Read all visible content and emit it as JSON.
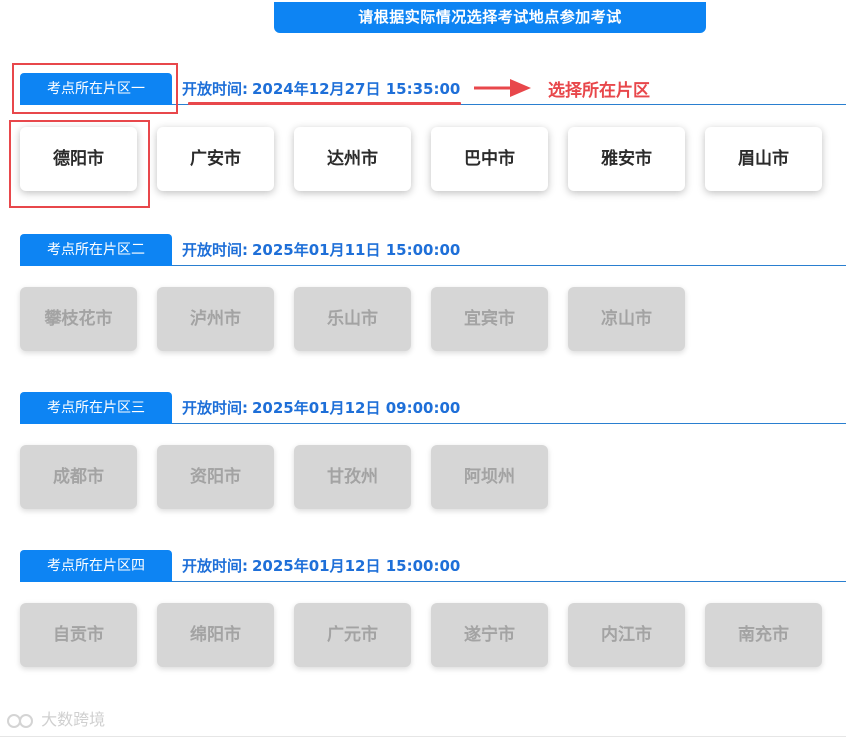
{
  "notice": "请根据实际情况选择考试地点参加考试",
  "regions": [
    {
      "tag": "考点所在片区一",
      "open_label": "开放时间:",
      "open_time": "2024年12月27日 15:35:00",
      "cities": [
        "德阳市",
        "广安市",
        "达州市",
        "巴中市",
        "雅安市",
        "眉山市"
      ]
    },
    {
      "tag": "考点所在片区二",
      "open_label": "开放时间:",
      "open_time": "2025年01月11日 15:00:00",
      "cities": [
        "攀枝花市",
        "泸州市",
        "乐山市",
        "宜宾市",
        "凉山市"
      ]
    },
    {
      "tag": "考点所在片区三",
      "open_label": "开放时间:",
      "open_time": "2025年01月12日 09:00:00",
      "cities": [
        "成都市",
        "资阳市",
        "甘孜州",
        "阿坝州"
      ]
    },
    {
      "tag": "考点所在片区四",
      "open_label": "开放时间:",
      "open_time": "2025年01月12日 15:00:00",
      "cities": [
        "自贡市",
        "绵阳市",
        "广元市",
        "遂宁市",
        "内江市",
        "南充市"
      ]
    }
  ],
  "annotation": {
    "text": "选择所在片区",
    "color": "#e8474b"
  },
  "watermark": "大数跨境",
  "colors": {
    "accent": "#0d84f3",
    "time_text": "#1e6fd8",
    "disabled_bg": "#d6d6d6",
    "disabled_text": "#a3a3a3"
  }
}
